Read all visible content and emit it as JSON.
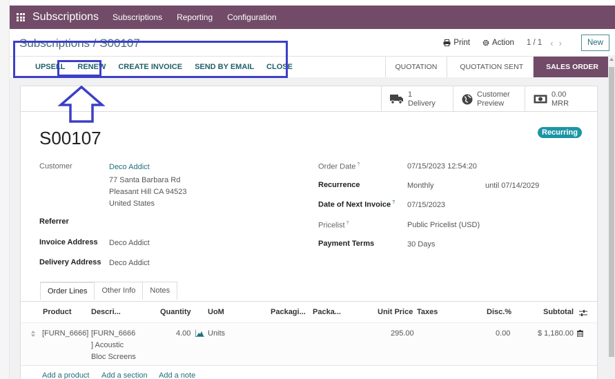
{
  "navbar": {
    "app_name": "Subscriptions",
    "menu": [
      "Subscriptions",
      "Reporting",
      "Configuration"
    ]
  },
  "control": {
    "breadcrumb": "Subscriptions / S00107",
    "print": "Print",
    "action": "Action",
    "pager": "1 / 1",
    "new": "New"
  },
  "header_buttons": [
    "UPSELL",
    "RENEW",
    "CREATE INVOICE",
    "SEND BY EMAIL",
    "CLOSE"
  ],
  "statusbar": {
    "stages": [
      "QUOTATION",
      "QUOTATION SENT",
      "SALES ORDER"
    ],
    "active": "SALES ORDER"
  },
  "smart_buttons": {
    "delivery": {
      "value": "1",
      "label": "Delivery"
    },
    "preview": {
      "line1": "Customer",
      "line2": "Preview"
    },
    "mrr": {
      "value": "0.00",
      "label": "MRR"
    }
  },
  "record": {
    "name": "S00107",
    "badge": "Recurring"
  },
  "left_fields": {
    "customer_label": "Customer",
    "customer_name": "Deco Addict",
    "address_line1": "77 Santa Barbara Rd",
    "address_line2": "Pleasant Hill CA 94523",
    "address_line3": "United States",
    "referrer_label": "Referrer",
    "invoice_label": "Invoice Address",
    "invoice_value": "Deco Addict",
    "delivery_label": "Delivery Address",
    "delivery_value": "Deco Addict"
  },
  "right_fields": {
    "order_date_label": "Order Date",
    "order_date": "07/15/2023 12:54:20",
    "recurrence_label": "Recurrence",
    "recurrence": "Monthly",
    "until": "until 07/14/2029",
    "next_invoice_label": "Date of Next Invoice",
    "next_invoice": "07/15/2023",
    "pricelist_label": "Pricelist",
    "pricelist": "Public Pricelist (USD)",
    "payment_terms_label": "Payment Terms",
    "payment_terms": "30 Days",
    "help_mark": "?"
  },
  "tabs": [
    "Order Lines",
    "Other Info",
    "Notes"
  ],
  "order_lines": {
    "columns": [
      "Product",
      "Descri...",
      "Quantity",
      "UoM",
      "Packagi...",
      "Packa...",
      "Unit Price",
      "Taxes",
      "Disc.%",
      "Subtotal"
    ],
    "rows": [
      {
        "product": "[FURN_6666]",
        "description_lines": [
          "[FURN_6666",
          "] Acoustic",
          "Bloc Screens"
        ],
        "quantity": "4.00",
        "uom": "Units",
        "unit_price": "295.00",
        "discount": "0.00",
        "subtotal": "$ 1,180.00"
      }
    ],
    "add_links": [
      "Add a product",
      "Add a section",
      "Add a note"
    ]
  },
  "colors": {
    "brand": "#714b67",
    "link": "#1f6f7a",
    "badge": "#1c95a5",
    "annotation": "#3c3fc8"
  }
}
